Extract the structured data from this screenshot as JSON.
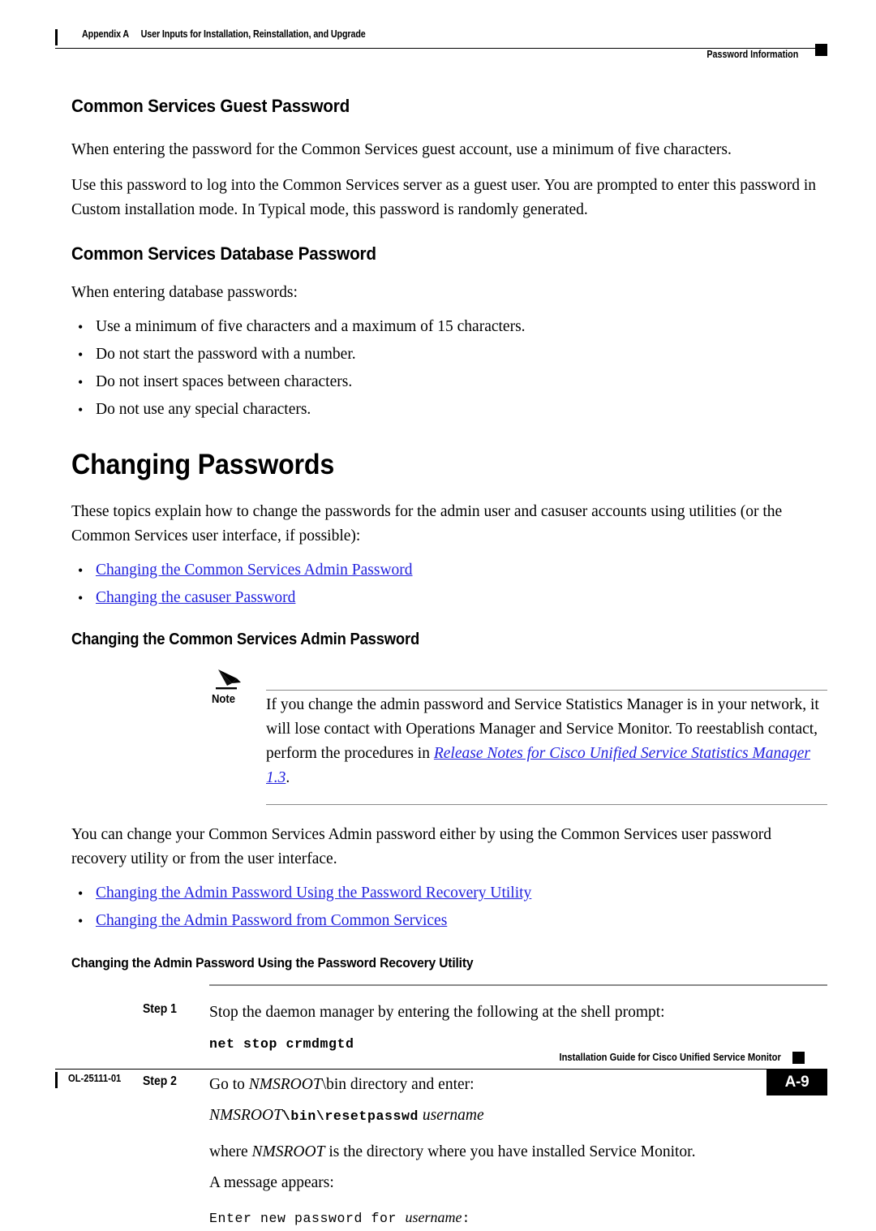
{
  "header": {
    "appendix": "Appendix A",
    "title": "User Inputs for Installation, Reinstallation, and Upgrade",
    "right": "Password Information"
  },
  "sections": {
    "guest": {
      "heading": "Common Services Guest Password",
      "p1": "When entering the password for the Common Services guest account, use a minimum of five characters.",
      "p2": "Use this password to log into the Common Services server as a guest user. You are prompted to enter this password in Custom installation mode. In Typical mode, this password is randomly generated."
    },
    "database": {
      "heading": "Common Services Database Password",
      "intro": "When entering database passwords:",
      "bullets": [
        "Use a minimum of five characters and a maximum of 15 characters.",
        "Do not start the password with a number.",
        "Do not insert spaces between characters.",
        "Do not use any special characters."
      ]
    },
    "changing": {
      "heading": "Changing Passwords",
      "intro": "These topics explain how to change the passwords for the admin user and casuser accounts using utilities (or the Common Services user interface, if possible):",
      "links": [
        "Changing the Common Services Admin Password",
        "Changing the casuser Password"
      ]
    },
    "admin": {
      "heading": "Changing the Common Services Admin Password",
      "note_label": "Note",
      "note_text_1": "If you change the admin password and Service Statistics Manager is in your network, it will lose contact with Operations Manager and Service Monitor. To reestablish contact, perform the procedures in ",
      "note_link": "Release Notes for Cisco Unified Service Statistics Manager 1.3",
      "note_text_2": ".",
      "p1": "You can change your Common Services Admin password either by using the Common Services user password recovery utility or from the user interface.",
      "links": [
        "Changing the Admin Password Using the Password Recovery Utility",
        "Changing the Admin Password from Common Services"
      ]
    },
    "recovery": {
      "heading": "Changing the Admin Password Using the Password Recovery Utility",
      "step1_label": "Step 1",
      "step1_text": "Stop the daemon manager by entering the following at the shell prompt:",
      "step1_cmd": "net stop crmdmgtd",
      "step2_label": "Step 2",
      "step2_text_pre": "Go to ",
      "step2_text_var": "NMSROOT",
      "step2_text_post": "\\bin directory and enter:",
      "step2_cmd_var": "NMSROOT",
      "step2_cmd_path": "\\bin\\resetpasswd",
      "step2_cmd_arg": "username",
      "p_where_pre": "where ",
      "p_where_var": "NMSROOT",
      "p_where_post": " is the directory where you have installed Service Monitor.",
      "p_message": "A message appears:",
      "msg_pre": "Enter new password for ",
      "msg_var": "username",
      "msg_post": ":"
    }
  },
  "footer": {
    "doc_id": "OL-25111-01",
    "guide_title": "Installation Guide for Cisco Unified Service Monitor",
    "page_number": "A-9"
  },
  "colors": {
    "link": "#2222dd",
    "rule_gray": "#8a8a8a",
    "text": "#000000"
  }
}
